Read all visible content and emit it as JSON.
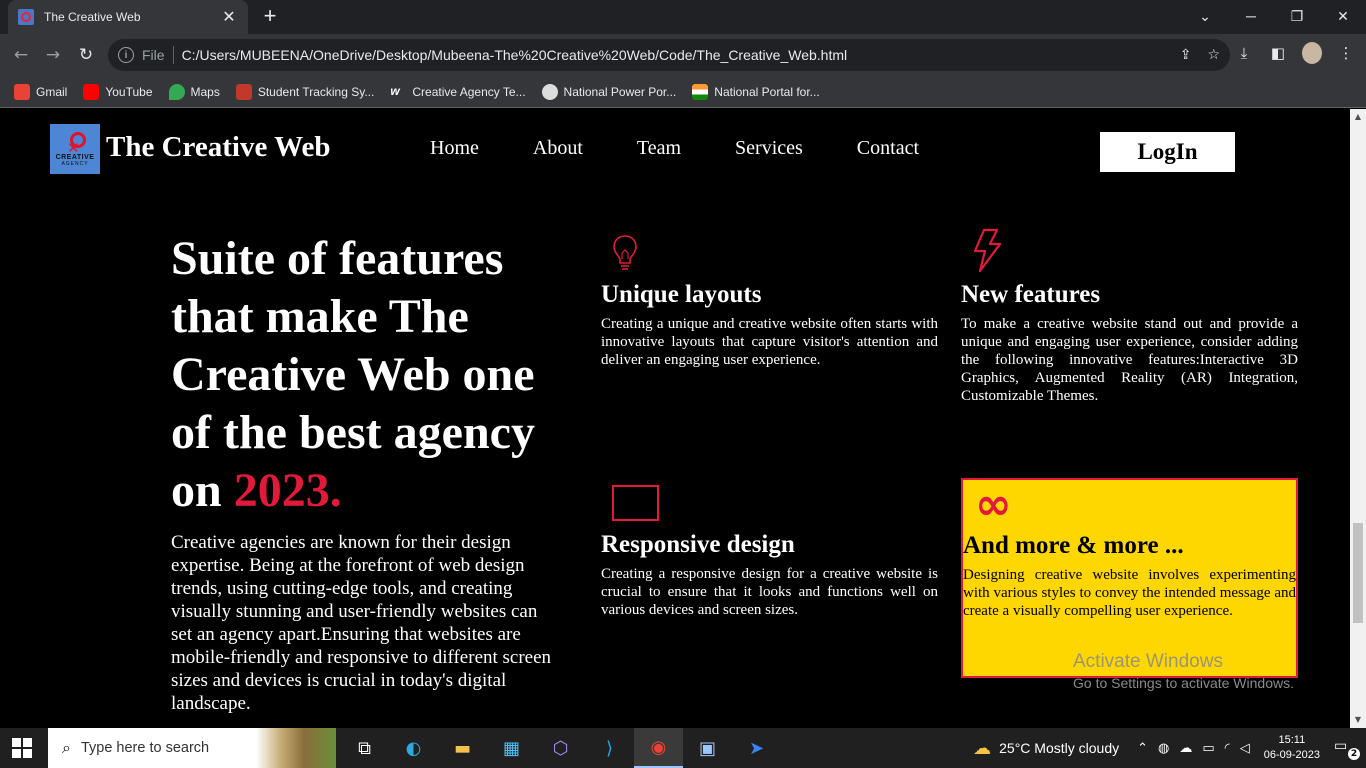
{
  "browser": {
    "tab_title": "The Creative Web",
    "new_tab": "+",
    "url_scheme": "File",
    "url": "C:/Users/MUBEENA/OneDrive/Desktop/Mubeena-The%20Creative%20Web/Code/The_Creative_Web.html",
    "bookmarks": [
      {
        "label": "Gmail",
        "color": "#ea4335"
      },
      {
        "label": "YouTube",
        "color": "#ff0000"
      },
      {
        "label": "Maps",
        "color": "#34a853"
      },
      {
        "label": "Student Tracking Sy...",
        "color": "#c0392b"
      },
      {
        "label": "Creative Agency Te...",
        "color": "#ffffff"
      },
      {
        "label": "National Power Por...",
        "color": "#dddddd"
      },
      {
        "label": "National Portal for...",
        "color": "#ff9933"
      }
    ]
  },
  "site": {
    "logo_text": "CREATIVE",
    "logo_sub": "AGENCY",
    "brand": "The Creative Web",
    "nav": [
      "Home",
      "About",
      "Team",
      "Services",
      "Contact"
    ],
    "login": "LogIn",
    "hero": {
      "title": "Suite of features that make The Creative Web one of the best agency on",
      "year": "2023.",
      "description": "Creative agencies are known for their design expertise. Being at the forefront of web design trends, using cutting-edge tools, and creating visually stunning and user-friendly websites can set an agency apart.Ensuring that websites are mobile-friendly and responsive to different screen sizes and devices is crucial in today's digital landscape."
    },
    "features": [
      {
        "title": "Unique layouts",
        "text": "Creating a unique and creative website often starts with innovative layouts that capture visitor's attention and deliver an engaging user experience.",
        "icon": "lightbulb-icon"
      },
      {
        "title": "New features",
        "text": "To make a creative website stand out and provide a unique and engaging user experience, consider adding the following innovative features:Interactive 3D Graphics, Augmented Reality (AR) Integration, Customizable Themes.",
        "icon": "lightning-icon"
      },
      {
        "title": "Responsive design",
        "text": "Creating a responsive design for a creative website is crucial to ensure that it looks and functions well on various devices and screen sizes.",
        "icon": "rectangle-icon"
      },
      {
        "title": "And more & more ...",
        "text": "Designing creative website involves experimenting with various styles to convey the intended message and create a visually compelling user experience.",
        "icon": "infinity-icon"
      }
    ],
    "accent_color": "#e3193a",
    "highlight_color": "#ffd700"
  },
  "watermark": {
    "line1": "Activate Windows",
    "line2": "Go to Settings to activate Windows."
  },
  "taskbar": {
    "search_placeholder": "Type here to search",
    "weather": "25°C  Mostly cloudy",
    "time": "15:11",
    "date": "06-09-2023",
    "notifications": "2"
  }
}
